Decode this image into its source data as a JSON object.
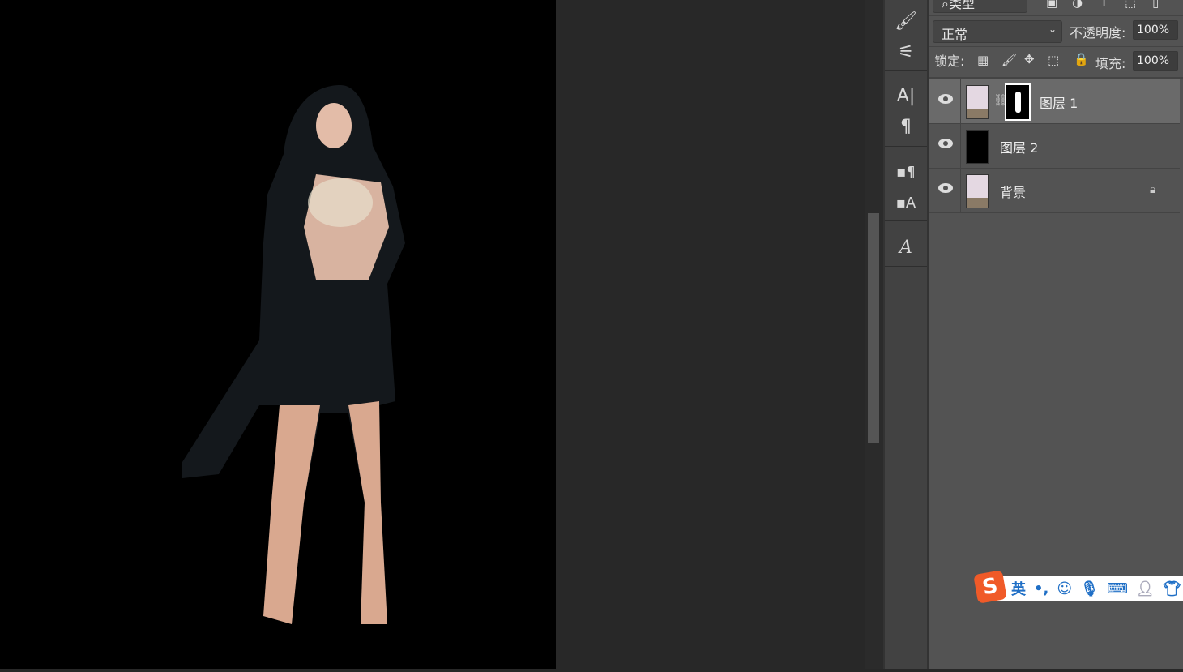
{
  "layers_panel": {
    "filter_kind": "类型",
    "blend_mode": "正常",
    "opacity_label": "不透明度:",
    "opacity_value": "100%",
    "lock_label": "锁定:",
    "fill_label": "填充:",
    "fill_value": "100%",
    "layers": [
      {
        "name": "图层 1",
        "selected": true,
        "has_mask": true
      },
      {
        "name": "图层 2",
        "selected": false
      },
      {
        "name": "背景",
        "selected": false,
        "locked": true
      }
    ]
  },
  "ime_bar": {
    "mode": "英",
    "punct": "•,"
  },
  "colors": {
    "accent_ime": "#f05a28",
    "panel_bg": "#535353",
    "canvas_bg": "#000000"
  }
}
